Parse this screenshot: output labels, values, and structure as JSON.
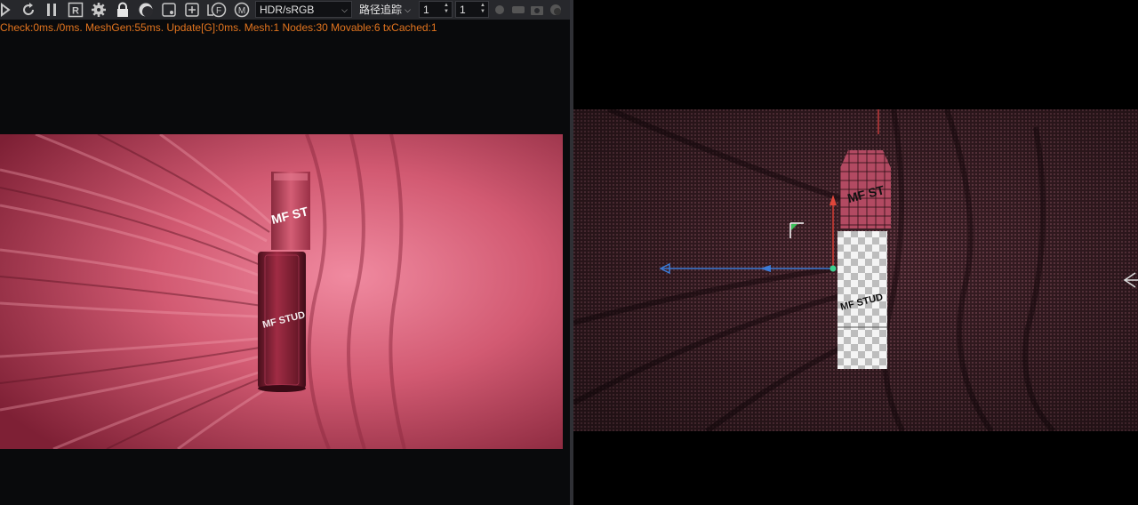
{
  "toolbar": {
    "color_mode_value": "HDR/sRGB",
    "tracing_value": "路径追踪",
    "spinner_a_value": "1",
    "spinner_b_value": "1",
    "icons": [
      "render-icon",
      "refresh-icon",
      "pause-icon",
      "region-r-icon",
      "gear-icon",
      "lock-icon",
      "sphere-icon",
      "scene-icon",
      "add-icon",
      "object-icon",
      "focus-f-icon",
      "material-m-icon",
      "clay-icon",
      "channels-icon",
      "camera-icon",
      "sphere-small-icon"
    ]
  },
  "stats": {
    "text": "Check:0ms./0ms. MeshGen:55ms. Update[G]:0ms. Mesh:1 Nodes:30 Movable:6 txCached:1"
  },
  "render": {
    "product_cap_text": "MF ST",
    "product_body_text": "MF STUD"
  },
  "wireframe": {
    "product_cap_text": "MF ST",
    "product_body_text": "MF STUD"
  },
  "colors": {
    "stats_text": "#e2741e",
    "backdrop": "#c4475f",
    "wire_bg": "#4a2a31",
    "axis_x": "#3b7bd6",
    "axis_y": "#e0463a"
  }
}
